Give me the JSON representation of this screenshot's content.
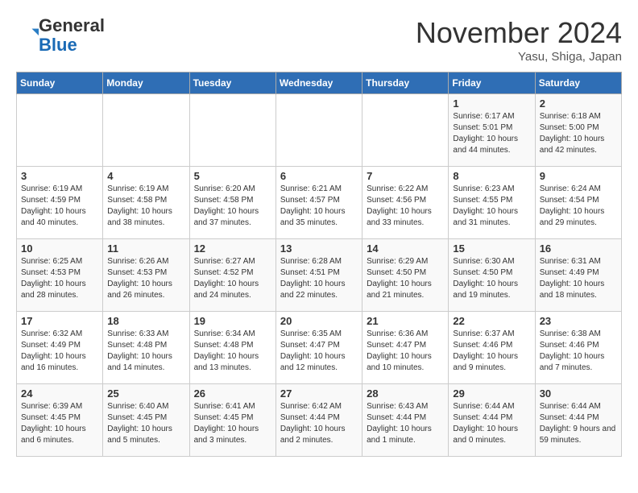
{
  "header": {
    "logo_general": "General",
    "logo_blue": "Blue",
    "month_title": "November 2024",
    "location": "Yasu, Shiga, Japan"
  },
  "weekdays": [
    "Sunday",
    "Monday",
    "Tuesday",
    "Wednesday",
    "Thursday",
    "Friday",
    "Saturday"
  ],
  "weeks": [
    [
      {
        "day": "",
        "info": ""
      },
      {
        "day": "",
        "info": ""
      },
      {
        "day": "",
        "info": ""
      },
      {
        "day": "",
        "info": ""
      },
      {
        "day": "",
        "info": ""
      },
      {
        "day": "1",
        "info": "Sunrise: 6:17 AM\nSunset: 5:01 PM\nDaylight: 10 hours\nand 44 minutes."
      },
      {
        "day": "2",
        "info": "Sunrise: 6:18 AM\nSunset: 5:00 PM\nDaylight: 10 hours\nand 42 minutes."
      }
    ],
    [
      {
        "day": "3",
        "info": "Sunrise: 6:19 AM\nSunset: 4:59 PM\nDaylight: 10 hours\nand 40 minutes."
      },
      {
        "day": "4",
        "info": "Sunrise: 6:19 AM\nSunset: 4:58 PM\nDaylight: 10 hours\nand 38 minutes."
      },
      {
        "day": "5",
        "info": "Sunrise: 6:20 AM\nSunset: 4:58 PM\nDaylight: 10 hours\nand 37 minutes."
      },
      {
        "day": "6",
        "info": "Sunrise: 6:21 AM\nSunset: 4:57 PM\nDaylight: 10 hours\nand 35 minutes."
      },
      {
        "day": "7",
        "info": "Sunrise: 6:22 AM\nSunset: 4:56 PM\nDaylight: 10 hours\nand 33 minutes."
      },
      {
        "day": "8",
        "info": "Sunrise: 6:23 AM\nSunset: 4:55 PM\nDaylight: 10 hours\nand 31 minutes."
      },
      {
        "day": "9",
        "info": "Sunrise: 6:24 AM\nSunset: 4:54 PM\nDaylight: 10 hours\nand 29 minutes."
      }
    ],
    [
      {
        "day": "10",
        "info": "Sunrise: 6:25 AM\nSunset: 4:53 PM\nDaylight: 10 hours\nand 28 minutes."
      },
      {
        "day": "11",
        "info": "Sunrise: 6:26 AM\nSunset: 4:53 PM\nDaylight: 10 hours\nand 26 minutes."
      },
      {
        "day": "12",
        "info": "Sunrise: 6:27 AM\nSunset: 4:52 PM\nDaylight: 10 hours\nand 24 minutes."
      },
      {
        "day": "13",
        "info": "Sunrise: 6:28 AM\nSunset: 4:51 PM\nDaylight: 10 hours\nand 22 minutes."
      },
      {
        "day": "14",
        "info": "Sunrise: 6:29 AM\nSunset: 4:50 PM\nDaylight: 10 hours\nand 21 minutes."
      },
      {
        "day": "15",
        "info": "Sunrise: 6:30 AM\nSunset: 4:50 PM\nDaylight: 10 hours\nand 19 minutes."
      },
      {
        "day": "16",
        "info": "Sunrise: 6:31 AM\nSunset: 4:49 PM\nDaylight: 10 hours\nand 18 minutes."
      }
    ],
    [
      {
        "day": "17",
        "info": "Sunrise: 6:32 AM\nSunset: 4:49 PM\nDaylight: 10 hours\nand 16 minutes."
      },
      {
        "day": "18",
        "info": "Sunrise: 6:33 AM\nSunset: 4:48 PM\nDaylight: 10 hours\nand 14 minutes."
      },
      {
        "day": "19",
        "info": "Sunrise: 6:34 AM\nSunset: 4:48 PM\nDaylight: 10 hours\nand 13 minutes."
      },
      {
        "day": "20",
        "info": "Sunrise: 6:35 AM\nSunset: 4:47 PM\nDaylight: 10 hours\nand 12 minutes."
      },
      {
        "day": "21",
        "info": "Sunrise: 6:36 AM\nSunset: 4:47 PM\nDaylight: 10 hours\nand 10 minutes."
      },
      {
        "day": "22",
        "info": "Sunrise: 6:37 AM\nSunset: 4:46 PM\nDaylight: 10 hours\nand 9 minutes."
      },
      {
        "day": "23",
        "info": "Sunrise: 6:38 AM\nSunset: 4:46 PM\nDaylight: 10 hours\nand 7 minutes."
      }
    ],
    [
      {
        "day": "24",
        "info": "Sunrise: 6:39 AM\nSunset: 4:45 PM\nDaylight: 10 hours\nand 6 minutes."
      },
      {
        "day": "25",
        "info": "Sunrise: 6:40 AM\nSunset: 4:45 PM\nDaylight: 10 hours\nand 5 minutes."
      },
      {
        "day": "26",
        "info": "Sunrise: 6:41 AM\nSunset: 4:45 PM\nDaylight: 10 hours\nand 3 minutes."
      },
      {
        "day": "27",
        "info": "Sunrise: 6:42 AM\nSunset: 4:44 PM\nDaylight: 10 hours\nand 2 minutes."
      },
      {
        "day": "28",
        "info": "Sunrise: 6:43 AM\nSunset: 4:44 PM\nDaylight: 10 hours\nand 1 minute."
      },
      {
        "day": "29",
        "info": "Sunrise: 6:44 AM\nSunset: 4:44 PM\nDaylight: 10 hours\nand 0 minutes."
      },
      {
        "day": "30",
        "info": "Sunrise: 6:44 AM\nSunset: 4:44 PM\nDaylight: 9 hours\nand 59 minutes."
      }
    ]
  ]
}
